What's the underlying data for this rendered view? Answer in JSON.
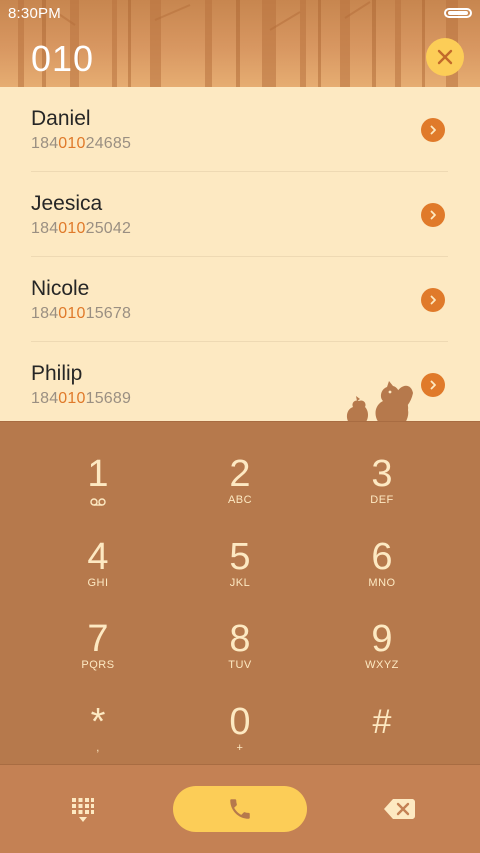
{
  "status_bar": {
    "time": "8:30PM"
  },
  "dialer": {
    "number": "010"
  },
  "contacts": [
    {
      "name": "Daniel",
      "number_prefix": "184",
      "number_match": "010",
      "number_suffix": "24685"
    },
    {
      "name": "Jeesica",
      "number_prefix": "184",
      "number_match": "010",
      "number_suffix": "25042"
    },
    {
      "name": "Nicole",
      "number_prefix": "184",
      "number_match": "010",
      "number_suffix": "15678"
    },
    {
      "name": "Philip",
      "number_prefix": "184",
      "number_match": "010",
      "number_suffix": "15689"
    }
  ],
  "keypad": [
    {
      "digit": "1",
      "letters": ""
    },
    {
      "digit": "2",
      "letters": "ABC"
    },
    {
      "digit": "3",
      "letters": "DEF"
    },
    {
      "digit": "4",
      "letters": "GHI"
    },
    {
      "digit": "5",
      "letters": "JKL"
    },
    {
      "digit": "6",
      "letters": "MNO"
    },
    {
      "digit": "7",
      "letters": "PQRS"
    },
    {
      "digit": "8",
      "letters": "TUV"
    },
    {
      "digit": "9",
      "letters": "WXYZ"
    },
    {
      "digit": "*",
      "letters": ","
    },
    {
      "digit": "0",
      "letters": "+"
    },
    {
      "digit": "#",
      "letters": ""
    }
  ],
  "icons": {
    "clear": "close-icon",
    "contact_detail": "chevron-right-icon",
    "voicemail": "voicemail-icon",
    "dialpad": "dialpad-icon",
    "call": "phone-icon",
    "backspace": "backspace-icon",
    "battery": "battery-icon",
    "mascot": "squirrel-icon"
  },
  "colors": {
    "accent": "#e07a2a",
    "button_yellow": "#fccd57",
    "list_bg": "#fde9c2",
    "keypad_bg": "#b6794c",
    "bottom_bar_bg": "#c48154"
  }
}
